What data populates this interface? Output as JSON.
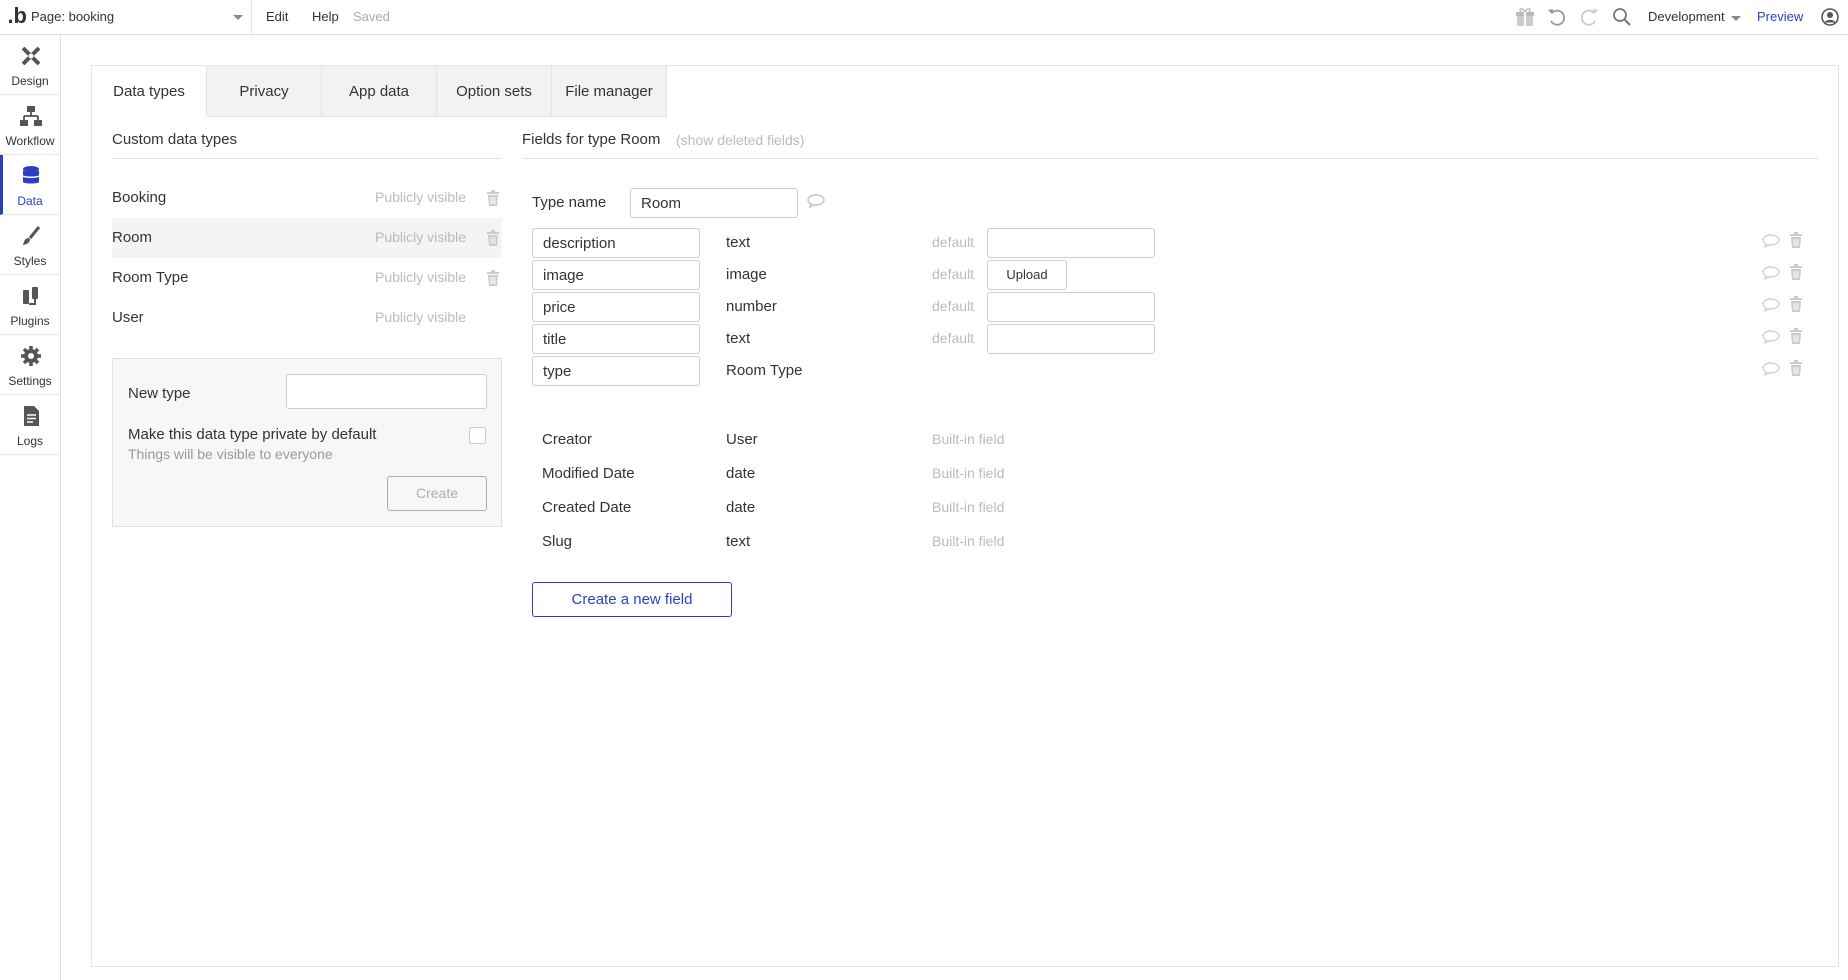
{
  "topbar": {
    "logo": ".b",
    "page_selector": "Page: booking",
    "menu": {
      "edit": "Edit",
      "help": "Help"
    },
    "status": "Saved",
    "environment": "Development",
    "preview": "Preview",
    "icons": [
      "gift-icon",
      "undo-icon",
      "redo-icon",
      "search-icon",
      "account-icon"
    ]
  },
  "leftnav": {
    "items": [
      {
        "label": "Design",
        "icon": "design-icon"
      },
      {
        "label": "Workflow",
        "icon": "workflow-icon"
      },
      {
        "label": "Data",
        "icon": "database-icon",
        "active": true
      },
      {
        "label": "Styles",
        "icon": "brush-icon"
      },
      {
        "label": "Plugins",
        "icon": "plug-icon"
      },
      {
        "label": "Settings",
        "icon": "gear-icon"
      },
      {
        "label": "Logs",
        "icon": "document-icon"
      }
    ]
  },
  "tabs": [
    {
      "label": "Data types",
      "active": true
    },
    {
      "label": "Privacy"
    },
    {
      "label": "App data"
    },
    {
      "label": "Option sets"
    },
    {
      "label": "File manager"
    }
  ],
  "types": {
    "header": "Custom data types",
    "items": [
      {
        "name": "Booking",
        "visibility": "Publicly visible"
      },
      {
        "name": "Room",
        "visibility": "Publicly visible",
        "selected": true
      },
      {
        "name": "Room Type",
        "visibility": "Publicly visible"
      },
      {
        "name": "User",
        "visibility": "Publicly visible"
      }
    ],
    "new_type": {
      "label": "New type",
      "value": "",
      "private_label": "Make this data type private by default",
      "private_sub": "Things will be visible to everyone",
      "create": "Create"
    }
  },
  "fields": {
    "title": "Fields for type Room",
    "show_deleted": "(show deleted fields)",
    "type_name_label": "Type name",
    "type_name_value": "Room",
    "custom": [
      {
        "name": "description",
        "type": "text",
        "default_label": "default",
        "default_value": ""
      },
      {
        "name": "image",
        "type": "image",
        "default_label": "default",
        "upload": "Upload"
      },
      {
        "name": "price",
        "type": "number",
        "default_label": "default",
        "default_value": ""
      },
      {
        "name": "title",
        "type": "text",
        "default_label": "default",
        "default_value": ""
      },
      {
        "name": "type",
        "type": "Room Type"
      }
    ],
    "builtin": [
      {
        "name": "Creator",
        "type": "User",
        "tag": "Built-in field"
      },
      {
        "name": "Modified Date",
        "type": "date",
        "tag": "Built-in field"
      },
      {
        "name": "Created Date",
        "type": "date",
        "tag": "Built-in field"
      },
      {
        "name": "Slug",
        "type": "text",
        "tag": "Built-in field"
      }
    ],
    "new_field": "Create a new field"
  },
  "colors": {
    "accent": "#2d3fbf",
    "muted": "#bbbbbb",
    "border": "#e4e4e4"
  }
}
